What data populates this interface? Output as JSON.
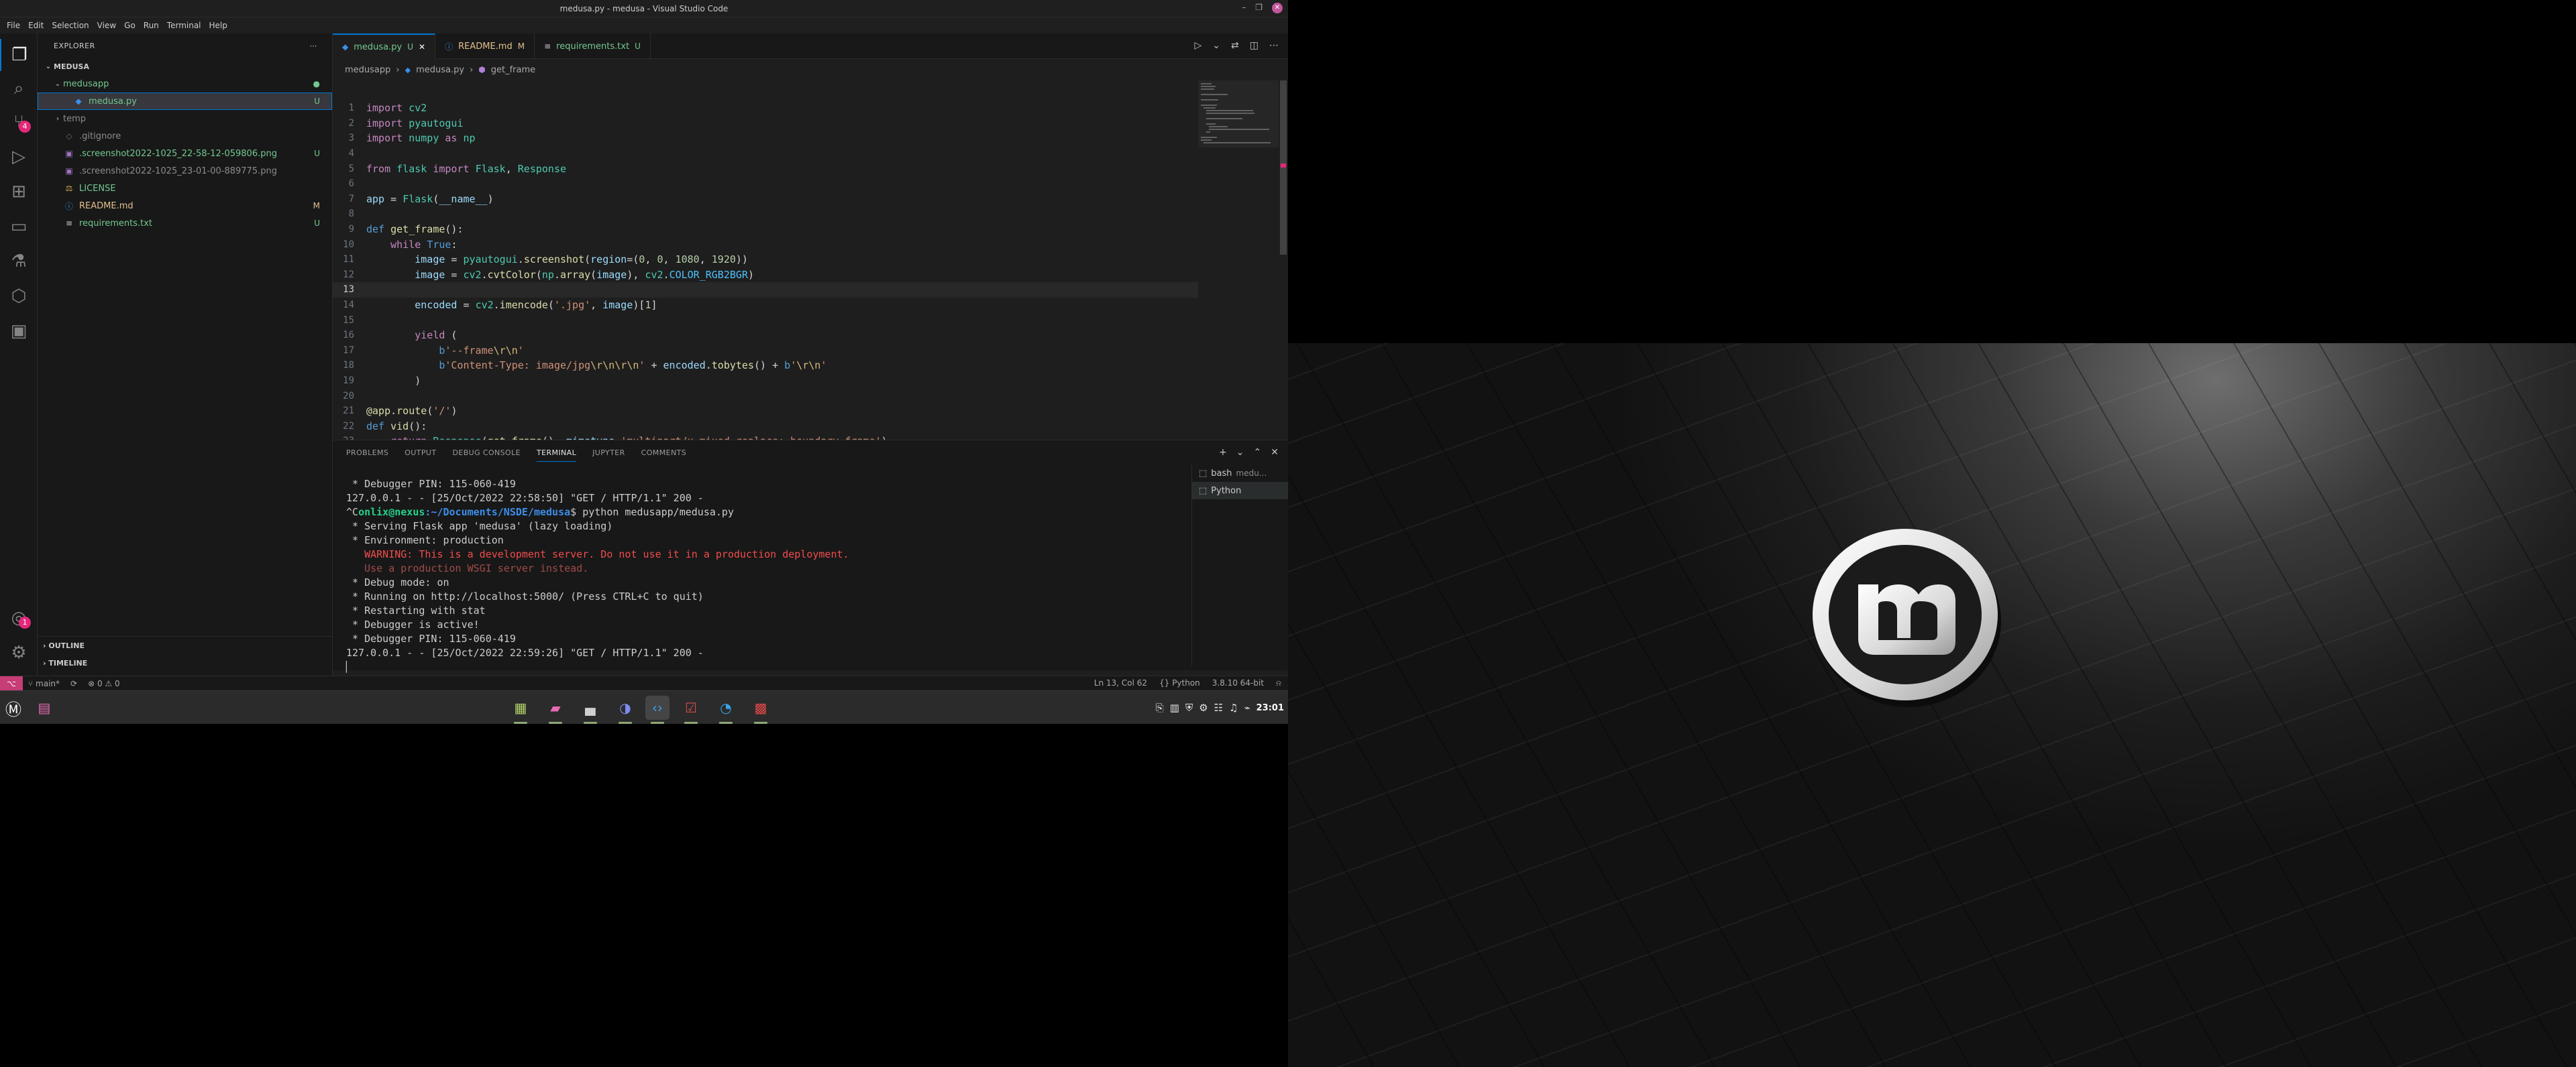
{
  "window": {
    "title": "medusa.py - medusa - Visual Studio Code"
  },
  "menu": [
    "File",
    "Edit",
    "Selection",
    "View",
    "Go",
    "Run",
    "Terminal",
    "Help"
  ],
  "activity_bar": {
    "scm_badge": "4",
    "accounts_badge": "1"
  },
  "explorer": {
    "header": "EXPLORER",
    "root": "MEDUSA",
    "items": [
      {
        "name": "medusapp",
        "type": "folder",
        "status": "●",
        "depth": 1,
        "class": "untracked"
      },
      {
        "name": "medusa.py",
        "type": "py",
        "status": "U",
        "depth": 2,
        "class": "untracked",
        "selected": true
      },
      {
        "name": "temp",
        "type": "folder-closed",
        "status": "",
        "depth": 1,
        "class": "ignored"
      },
      {
        "name": ".gitignore",
        "type": "git",
        "status": "",
        "depth": 1,
        "class": "ignored"
      },
      {
        "name": ".screenshot2022-1025_22-58-12-059806.png",
        "type": "img",
        "status": "U",
        "depth": 1,
        "class": "untracked"
      },
      {
        "name": ".screenshot2022-1025_23-01-00-889775.png",
        "type": "img",
        "status": "",
        "depth": 1,
        "class": "ignored"
      },
      {
        "name": "LICENSE",
        "type": "lic",
        "status": "",
        "depth": 1,
        "class": "untracked"
      },
      {
        "name": "README.md",
        "type": "md",
        "status": "M",
        "depth": 1,
        "class": "modified"
      },
      {
        "name": "requirements.txt",
        "type": "txt",
        "status": "U",
        "depth": 1,
        "class": "untracked"
      }
    ],
    "outline": "OUTLINE",
    "timeline": "TIMELINE"
  },
  "tabs": [
    {
      "label": "medusa.py",
      "mark": "U",
      "active": true,
      "class": "untracked"
    },
    {
      "label": "README.md",
      "mark": "M",
      "active": false,
      "class": "modified"
    },
    {
      "label": "requirements.txt",
      "mark": "U",
      "active": false,
      "class": "untracked"
    }
  ],
  "breadcrumb": [
    "medusapp",
    "medusa.py",
    "get_frame"
  ],
  "code_lines": [
    {
      "n": "1",
      "html": "<span class='kw'>import</span> <span class='cls'>cv2</span>"
    },
    {
      "n": "2",
      "html": "<span class='kw'>import</span> <span class='cls'>pyautogui</span>"
    },
    {
      "n": "3",
      "html": "<span class='kw'>import</span> <span class='cls'>numpy</span> <span class='kw'>as</span> <span class='cls'>np</span>"
    },
    {
      "n": "4",
      "html": ""
    },
    {
      "n": "5",
      "html": "<span class='kw'>from</span> <span class='cls'>flask</span> <span class='kw'>import</span> <span class='cls'>Flask</span>, <span class='cls'>Response</span>"
    },
    {
      "n": "6",
      "html": ""
    },
    {
      "n": "7",
      "html": "<span class='var'>app</span> = <span class='cls'>Flask</span>(<span class='var'>__name__</span>)"
    },
    {
      "n": "8",
      "html": ""
    },
    {
      "n": "9",
      "html": "<span class='kw2'>def</span> <span class='fn'>get_frame</span>():"
    },
    {
      "n": "10",
      "html": "    <span class='kw'>while</span> <span class='kw2'>True</span>:"
    },
    {
      "n": "11",
      "html": "        <span class='var'>image</span> = <span class='cls'>pyautogui</span>.<span class='fn'>screenshot</span>(<span class='var'>region</span>=(<span class='num'>0</span>, <span class='num'>0</span>, <span class='num'>1080</span>, <span class='num'>1920</span>))"
    },
    {
      "n": "12",
      "html": "        <span class='var'>image</span> = <span class='cls'>cv2</span>.<span class='fn'>cvtColor</span>(<span class='cls'>np</span>.<span class='fn'>array</span>(<span class='var'>image</span>), <span class='cls'>cv2</span>.<span class='const'>COLOR_RGB2BGR</span>)"
    },
    {
      "n": "13",
      "html": ""
    },
    {
      "n": "14",
      "html": "        <span class='var'>encoded</span> = <span class='cls'>cv2</span>.<span class='fn'>imencode</span>(<span class='str'>'.jpg'</span>, <span class='var'>image</span>)[<span class='num'>1</span>]"
    },
    {
      "n": "15",
      "html": ""
    },
    {
      "n": "16",
      "html": "        <span class='kw'>yield</span> ("
    },
    {
      "n": "17",
      "html": "            <span class='kw2'>b</span><span class='str'>'--frame</span><span class='esc'>\\r\\n</span><span class='str'>'</span>"
    },
    {
      "n": "18",
      "html": "            <span class='kw2'>b</span><span class='str'>'Content-Type: image/jpg</span><span class='esc'>\\r\\n\\r\\n</span><span class='str'>'</span> + <span class='var'>encoded</span>.<span class='fn'>tobytes</span>() + <span class='kw2'>b</span><span class='str'>'</span><span class='esc'>\\r\\n</span><span class='str'>'</span>"
    },
    {
      "n": "19",
      "html": "        )"
    },
    {
      "n": "20",
      "html": ""
    },
    {
      "n": "21",
      "html": "<span class='dec'>@app.route</span>(<span class='str'>'/'</span>)"
    },
    {
      "n": "22",
      "html": "<span class='kw2'>def</span> <span class='fn'>vid</span>():"
    },
    {
      "n": "23",
      "html": "    <span class='kw'>return</span> <span class='cls'>Response</span>(<span class='fn'>get_frame</span>(), <span class='var'>mimetype</span>=<span class='str'>'multipart/x-mixed-replace; boundary=frame'</span>)"
    }
  ],
  "current_line": "13",
  "panel": {
    "tabs": [
      "PROBLEMS",
      "OUTPUT",
      "DEBUG CONSOLE",
      "TERMINAL",
      "JUPYTER",
      "COMMENTS"
    ],
    "active_tab": "TERMINAL",
    "terminal_lines": [
      {
        "t": " * Debugger PIN: 115-060-419",
        "c": ""
      },
      {
        "t": "127.0.0.1 - - [25/Oct/2022 22:58:50] \"GET / HTTP/1.1\" 200 -",
        "c": ""
      },
      {
        "t": "PROMPT",
        "c": "prompt"
      },
      {
        "t": " * Serving Flask app 'medusa' (lazy loading)",
        "c": ""
      },
      {
        "t": " * Environment: production",
        "c": ""
      },
      {
        "t": "   WARNING: This is a development server. Do not use it in a production deployment.",
        "c": "warn"
      },
      {
        "t": "   Use a production WSGI server instead.",
        "c": "dim"
      },
      {
        "t": " * Debug mode: on",
        "c": ""
      },
      {
        "t": " * Running on http://localhost:5000/ (Press CTRL+C to quit)",
        "c": ""
      },
      {
        "t": " * Restarting with stat",
        "c": ""
      },
      {
        "t": " * Debugger is active!",
        "c": ""
      },
      {
        "t": " * Debugger PIN: 115-060-419",
        "c": ""
      },
      {
        "t": "127.0.0.1 - - [25/Oct/2022 22:59:26] \"GET / HTTP/1.1\" 200 -",
        "c": ""
      },
      {
        "t": "▏",
        "c": ""
      }
    ],
    "prompt": {
      "prefix": "^C",
      "user": "onlix@nexus",
      "path": ":~/Documents/NSDE/medusa",
      "cmd": "$ python medusapp/medusa.py"
    },
    "terminals": [
      {
        "name": "bash",
        "sub": "medu..."
      },
      {
        "name": "Python",
        "sub": ""
      }
    ]
  },
  "statusbar": {
    "branch": "main*",
    "sync": "⟳",
    "problems": "⊗ 0 ⚠ 0",
    "position": "Ln 13, Col 62",
    "language": "Python",
    "interpreter": "3.8.10 64-bit"
  },
  "taskbar": {
    "clock": "23:01"
  }
}
